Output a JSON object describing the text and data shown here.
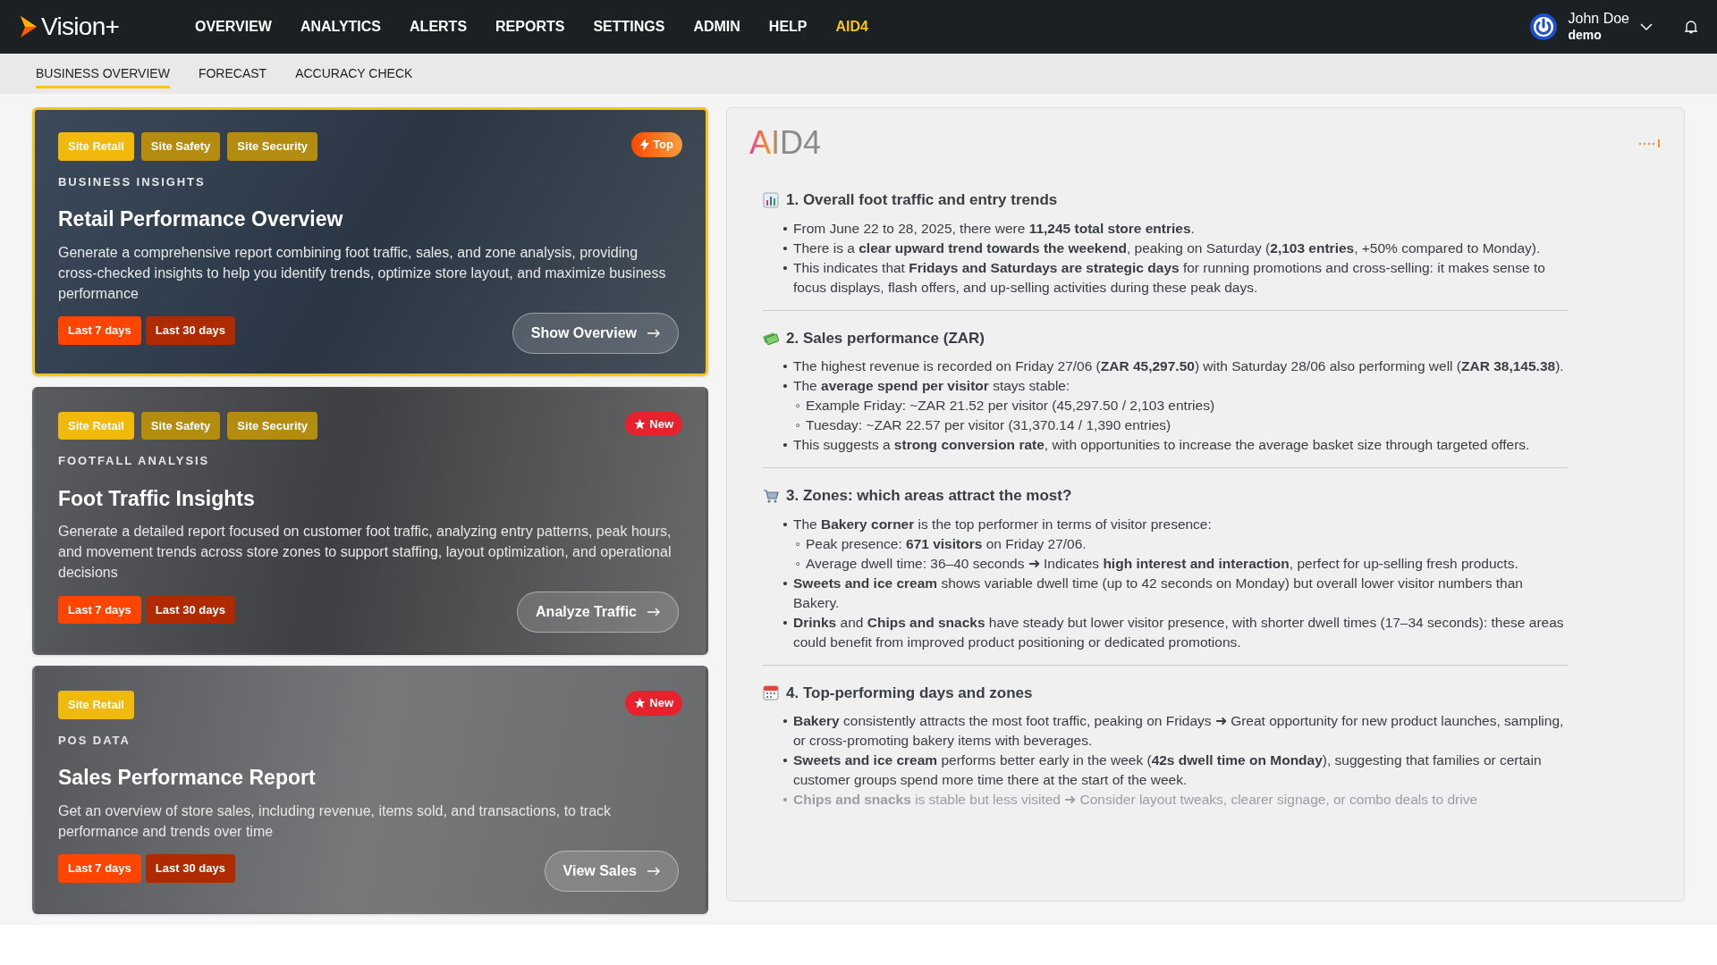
{
  "header": {
    "logo": "Vision+",
    "nav": [
      {
        "label": "OVERVIEW",
        "selected": false
      },
      {
        "label": "ANALYTICS",
        "selected": false
      },
      {
        "label": "ALERTS",
        "selected": false
      },
      {
        "label": "REPORTS",
        "selected": false
      },
      {
        "label": "SETTINGS",
        "selected": false
      },
      {
        "label": "ADMIN",
        "selected": false
      },
      {
        "label": "HELP",
        "selected": false
      },
      {
        "label": "AID4",
        "selected": true
      }
    ],
    "user": {
      "name": "John Doe",
      "role": "demo"
    }
  },
  "subtabs": [
    {
      "label": "BUSINESS OVERVIEW",
      "selected": true
    },
    {
      "label": "FORECAST",
      "selected": false
    },
    {
      "label": "ACCURACY CHECK",
      "selected": false
    }
  ],
  "cards": [
    {
      "highlighted": true,
      "tags": [
        {
          "label": "Site Retail",
          "selected": true
        },
        {
          "label": "Site Safety",
          "selected": false
        },
        {
          "label": "Site Security",
          "selected": false
        }
      ],
      "badge": {
        "kind": "top",
        "label": "Top"
      },
      "category": "BUSINESS INSIGHTS",
      "title": "Retail Performance Overview",
      "description": "Generate a comprehensive report combining foot traffic, sales, and zone analysis, providing cross-checked insights to help you identify trends, optimize store layout, and maximize business performance",
      "ranges": [
        {
          "label": "Last 7 days",
          "selected": true
        },
        {
          "label": "Last 30 days",
          "selected": false
        }
      ],
      "action": "Show Overview"
    },
    {
      "highlighted": false,
      "tags": [
        {
          "label": "Site Retail",
          "selected": true
        },
        {
          "label": "Site Safety",
          "selected": false
        },
        {
          "label": "Site Security",
          "selected": false
        }
      ],
      "badge": {
        "kind": "new",
        "label": "New"
      },
      "category": "FOOTFALL ANALYSIS",
      "title": "Foot Traffic Insights",
      "description": "Generate a detailed report focused on customer foot traffic, analyzing entry patterns, peak hours, and movement trends across store zones to support staffing, layout optimization, and operational decisions",
      "ranges": [
        {
          "label": "Last 7 days",
          "selected": true
        },
        {
          "label": "Last 30 days",
          "selected": false
        }
      ],
      "action": "Analyze Traffic"
    },
    {
      "highlighted": false,
      "tags": [
        {
          "label": "Site Retail",
          "selected": true
        }
      ],
      "badge": {
        "kind": "new",
        "label": "New"
      },
      "category": "POS DATA",
      "title": "Sales Performance Report",
      "description": "Get an overview of store sales, including revenue, items sold, and transactions, to track performance and trends over time",
      "ranges": [
        {
          "label": "Last 7 days",
          "selected": true
        },
        {
          "label": "Last 30 days",
          "selected": false
        }
      ],
      "action": "View Sales"
    }
  ],
  "assistant": {
    "logo": "AID4",
    "sections": [
      {
        "kind": "chart",
        "title": "1. Overall foot traffic and entry trends",
        "items": [
          {
            "marker": "•",
            "text": "From June 22 to 28, 2025, there were **11,245 total store entries**."
          },
          {
            "marker": "•",
            "text": "There is a **clear upward trend towards the weekend**, peaking on Saturday (**2,103 entries**, +50% compared to Monday)."
          },
          {
            "marker": "•",
            "text": "This indicates that **Fridays and Saturdays are strategic days** for running promotions and cross-selling: it makes sense to focus displays, flash offers, and up-selling activities during these peak days."
          }
        ]
      },
      {
        "kind": "money",
        "title": "2. Sales performance (ZAR)",
        "items": [
          {
            "marker": "•",
            "text": "The highest revenue is recorded on Friday 27/06 (**ZAR 45,297.50**) with Saturday 28/06 also performing well (**ZAR 38,145.38**)."
          },
          {
            "marker": "•",
            "text": "The **average spend per visitor** stays stable:",
            "children": [
              {
                "marker": "◦",
                "text": "Example Friday: ~ZAR 21.52 per visitor (45,297.50 / 2,103 entries)"
              },
              {
                "marker": "◦",
                "text": "Tuesday: ~ZAR 22.57 per visitor (31,370.14 / 1,390 entries)"
              }
            ]
          },
          {
            "marker": "•",
            "text": "This suggests a **strong conversion rate**, with opportunities to increase the average basket size through targeted offers."
          }
        ]
      },
      {
        "kind": "cart",
        "title": "3. Zones: which areas attract the most?",
        "items": [
          {
            "marker": "•",
            "text": "The **Bakery corner** is the top performer in terms of visitor presence:",
            "children": [
              {
                "marker": "◦",
                "text": "Peak presence: **671 visitors** on Friday 27/06."
              },
              {
                "marker": "◦",
                "text": "Average dwell time: 36–40 seconds ➜ Indicates **high interest and interaction**, perfect for up-selling fresh products."
              }
            ]
          },
          {
            "marker": "•",
            "text": "**Sweets and ice cream** shows variable dwell time (up to 42 seconds on Monday) but overall lower visitor numbers than Bakery."
          },
          {
            "marker": "•",
            "text": "**Drinks** and **Chips and snacks** have steady but lower visitor presence, with shorter dwell times (17–34 seconds): these areas could benefit from improved product positioning or dedicated promotions."
          }
        ]
      },
      {
        "kind": "calendar",
        "title": "4. Top-performing days and zones",
        "items": [
          {
            "marker": "•",
            "text": "**Bakery** consistently attracts the most foot traffic, peaking on Fridays ➜ Great opportunity for new product launches, sampling, or cross-promoting bakery items with beverages."
          },
          {
            "marker": "•",
            "text": "**Sweets and ice cream** performs better early in the week (**42s dwell time on Monday**), suggesting that families or certain customer groups spend more time there at the start of the week."
          },
          {
            "marker": "•",
            "text": "**Chips and snacks** is stable but less visited ➜ Consider layout tweaks, clearer signage, or combo deals to drive",
            "faded": true
          }
        ]
      }
    ]
  }
}
